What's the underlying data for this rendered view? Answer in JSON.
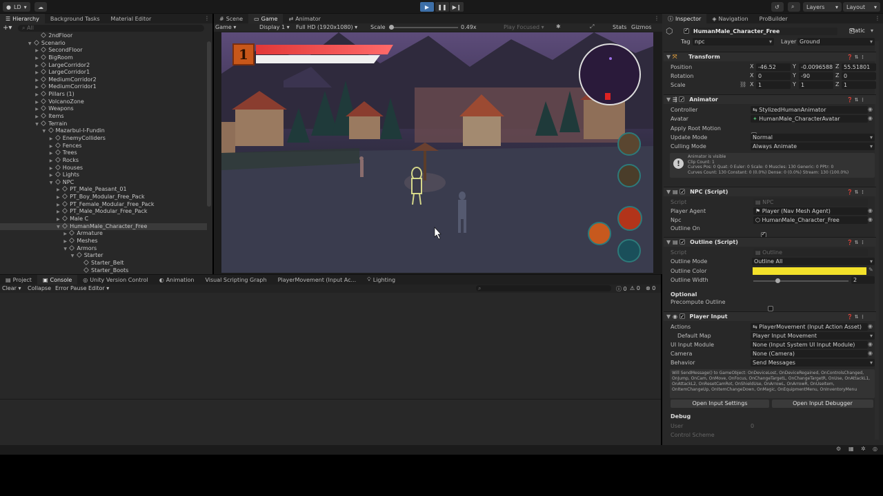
{
  "toolbar": {
    "account": "LD",
    "layers": "Layers",
    "layout": "Layout"
  },
  "hierarchy": {
    "tabs": [
      "Hierarchy",
      "Background Tasks",
      "Material Editor"
    ],
    "search_placeholder": "All",
    "rows": [
      {
        "label": "2ndFloor",
        "indent": 4,
        "arrow": ""
      },
      {
        "label": "Scenario",
        "indent": 3,
        "arrow": "▼"
      },
      {
        "label": "SecondFloor",
        "indent": 4,
        "arrow": "▶"
      },
      {
        "label": "BigRoom",
        "indent": 4,
        "arrow": "▶"
      },
      {
        "label": "LargeCorridor2",
        "indent": 4,
        "arrow": "▶"
      },
      {
        "label": "LargeCorridor1",
        "indent": 4,
        "arrow": "▶"
      },
      {
        "label": "MediumCorridor2",
        "indent": 4,
        "arrow": "▶"
      },
      {
        "label": "MediumCorridor1",
        "indent": 4,
        "arrow": "▶"
      },
      {
        "label": "Pillars (1)",
        "indent": 4,
        "arrow": "▶"
      },
      {
        "label": "VolcanoZone",
        "indent": 4,
        "arrow": "▶"
      },
      {
        "label": "Weapons",
        "indent": 4,
        "arrow": "▶"
      },
      {
        "label": "Items",
        "indent": 4,
        "arrow": "▶"
      },
      {
        "label": "Terrain",
        "indent": 4,
        "arrow": "▼"
      },
      {
        "label": "Mazarbul-I-Fundin",
        "indent": 5,
        "arrow": "▼"
      },
      {
        "label": "EnemyColliders",
        "indent": 6,
        "arrow": "▶"
      },
      {
        "label": "Fences",
        "indent": 6,
        "arrow": "▶"
      },
      {
        "label": "Trees",
        "indent": 6,
        "arrow": "▶"
      },
      {
        "label": "Rocks",
        "indent": 6,
        "arrow": "▶"
      },
      {
        "label": "Houses",
        "indent": 6,
        "arrow": "▶"
      },
      {
        "label": "Lights",
        "indent": 6,
        "arrow": "▶"
      },
      {
        "label": "NPC",
        "indent": 6,
        "arrow": "▼"
      },
      {
        "label": "PT_Male_Peasant_01",
        "indent": 7,
        "arrow": "▶"
      },
      {
        "label": "PT_Boy_Modular_Free_Pack",
        "indent": 7,
        "arrow": "▶"
      },
      {
        "label": "PT_Female_Modular_Free_Pack",
        "indent": 7,
        "arrow": "▶"
      },
      {
        "label": "PT_Male_Modular_Free_Pack",
        "indent": 7,
        "arrow": "▶"
      },
      {
        "label": "Male C",
        "indent": 7,
        "arrow": "▶"
      },
      {
        "label": "HumanMale_Character_Free",
        "indent": 7,
        "arrow": "▼",
        "selected": true
      },
      {
        "label": "Armature",
        "indent": 8,
        "arrow": "▶"
      },
      {
        "label": "Meshes",
        "indent": 8,
        "arrow": "▶"
      },
      {
        "label": "Armors",
        "indent": 8,
        "arrow": "▼"
      },
      {
        "label": "Starter",
        "indent": 9,
        "arrow": "▼"
      },
      {
        "label": "Starter_Belt",
        "indent": 10,
        "arrow": ""
      },
      {
        "label": "Starter_Boots",
        "indent": 10,
        "arrow": ""
      }
    ]
  },
  "gamepanel": {
    "tabs": [
      "Scene",
      "Game",
      "Animator"
    ],
    "mode": "Game",
    "display": "Display 1",
    "resolution": "Full HD (1920x1080)",
    "scale_label": "Scale",
    "scale_value": "0.49x",
    "play_focused": "Play Focused",
    "stats": "Stats",
    "gizmos": "Gizmos",
    "hud_level": "1",
    "health_fraction": 0.88
  },
  "console": {
    "tabs": [
      "Project",
      "Console",
      "Unity Version Control",
      "Animation",
      "Visual Scripting Graph",
      "PlayerMovement (Input Ac...",
      "Lighting"
    ],
    "buttons": [
      "Clear",
      "Collapse",
      "Error Pause",
      "Editor"
    ],
    "counts": [
      "0",
      "0",
      "0"
    ]
  },
  "inspector": {
    "tabs": [
      "Inspector",
      "Navigation",
      "ProBuilder"
    ],
    "object_name": "HumanMale_Character_Free",
    "static_label": "Static",
    "tag_label": "Tag",
    "tag": "npc",
    "layer_label": "Layer",
    "layer": "Ground",
    "transform": {
      "title": "Transform",
      "position": {
        "label": "Position",
        "x": "-46.52",
        "y": "-0.0096588",
        "z": "55.51801"
      },
      "rotation": {
        "label": "Rotation",
        "x": "0",
        "y": "-90",
        "z": "0"
      },
      "scale": {
        "label": "Scale",
        "x": "1",
        "y": "1",
        "z": "1"
      }
    },
    "animator": {
      "title": "Animator",
      "controller_label": "Controller",
      "controller": "StylizedHumanAnimator",
      "avatar_label": "Avatar",
      "avatar": "HumanMale_CharacterAvatar",
      "root_motion_label": "Apply Root Motion",
      "update_mode_label": "Update Mode",
      "update_mode": "Normal",
      "culling_label": "Culling Mode",
      "culling": "Always Animate",
      "info1": "Animator is visible",
      "info2": "Clip Count: 1",
      "info3": "Curves Pos: 0 Quat: 0 Euler: 0 Scale: 0 Muscles: 130 Generic: 0 PPtr: 0",
      "info4": "Curves Count: 130 Constant: 0 (0.0%) Dense: 0 (0.0%) Stream: 130 (100.0%)"
    },
    "npc": {
      "title": "NPC (Script)",
      "script_label": "Script",
      "script": "NPC",
      "agent_label": "Player Agent",
      "agent": "Player (Nav Mesh Agent)",
      "npc_label": "Npc",
      "npc": "HumanMale_Character_Free",
      "outline_on_label": "Outline On"
    },
    "outline": {
      "title": "Outline (Script)",
      "script_label": "Script",
      "script": "Outline",
      "mode_label": "Outline Mode",
      "mode": "Outline All",
      "color_label": "Outline Color",
      "color": "#f3e12a",
      "width_label": "Outline Width",
      "width": "2",
      "optional_label": "Optional",
      "precompute_label": "Precompute Outline"
    },
    "player_input": {
      "title": "Player Input",
      "actions_label": "Actions",
      "actions": "PlayerMovement (Input Action Asset)",
      "map_label": "Default Map",
      "map": "Player Input Movement",
      "ui_label": "UI Input Module",
      "ui": "None (Input System UI Input Module)",
      "camera_label": "Camera",
      "camera": "None (Camera)",
      "behavior_label": "Behavior",
      "behavior": "Send Messages",
      "messages": "Will SendMessage() to GameObject: OnDeviceLost, OnDeviceRegained, OnControlsChanged, OnJump, OnCam, OnMove, OnFocus, OnChangeTargetL, OnChangeTargetR, OnUse, OnAttackL1, OnAttackL2, OnResetCamRot, OnShieldUse, OnArrowL, OnArrowR, OnUseItem, OnItemChangeUp, OnItemChangeDown, OnMagic, OnEquipmentMenu, OnInventoryMenu",
      "open_settings": "Open Input Settings",
      "open_debugger": "Open Input Debugger"
    },
    "debug": {
      "title": "Debug",
      "user_label": "User",
      "user": "0",
      "scheme_label": "Control Scheme"
    }
  }
}
